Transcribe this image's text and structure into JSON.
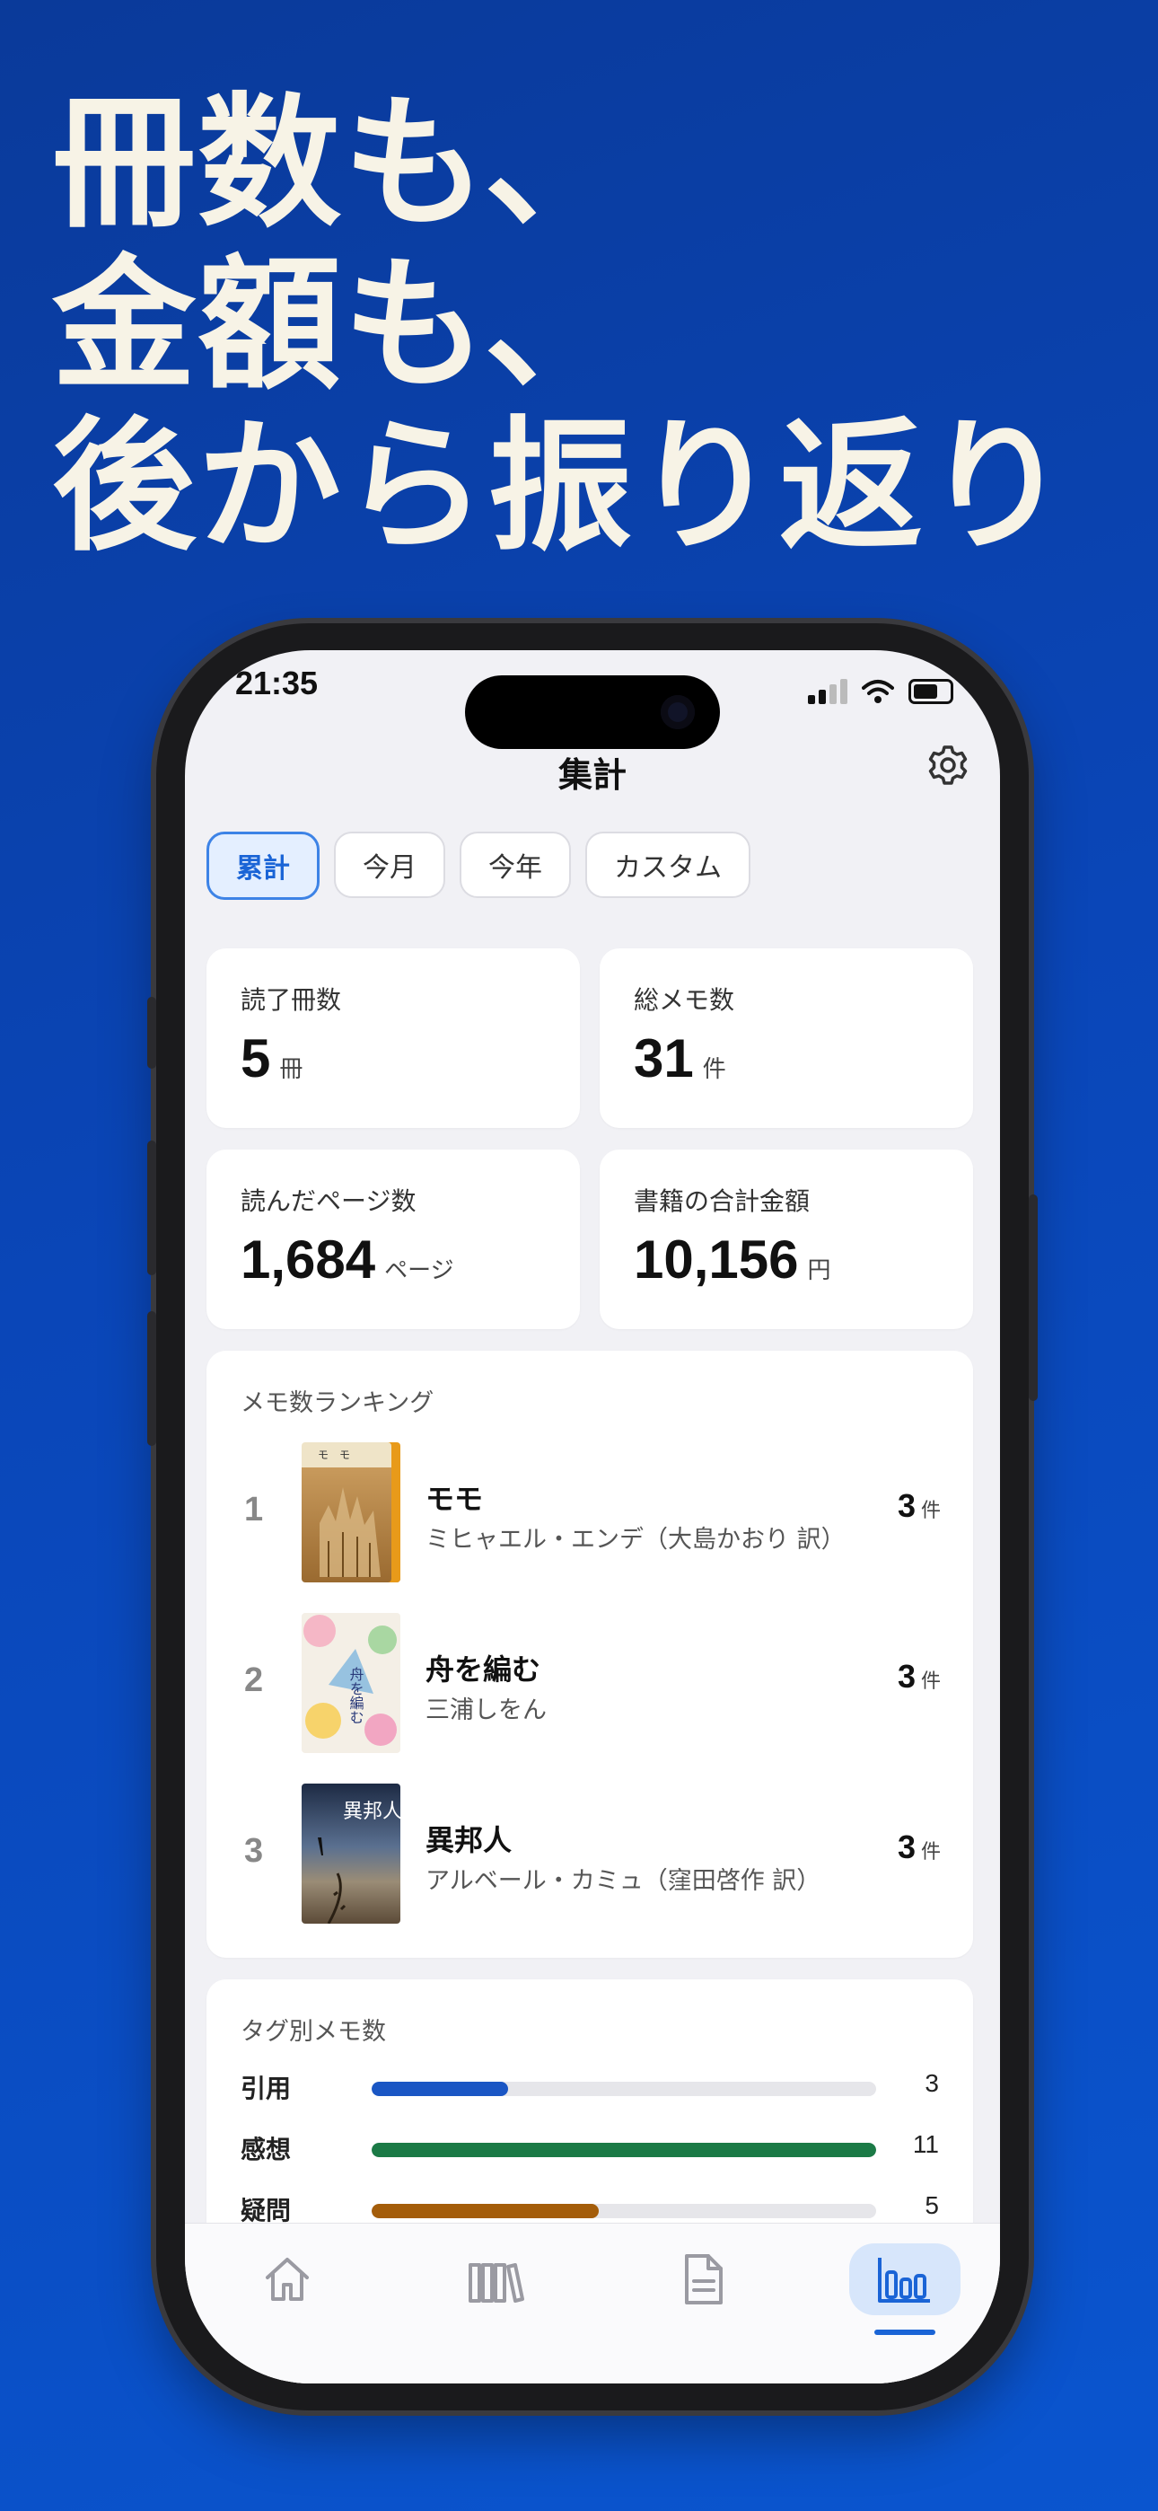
{
  "headline": [
    "冊数も、",
    "金額も、",
    "後から振り返り"
  ],
  "status": {
    "time": "21:35"
  },
  "nav": {
    "title": "集計"
  },
  "segments": [
    {
      "label": "累計",
      "selected": true
    },
    {
      "label": "今月",
      "selected": false
    },
    {
      "label": "今年",
      "selected": false
    },
    {
      "label": "カスタム",
      "selected": false
    }
  ],
  "stats": {
    "books_read": {
      "label": "読了冊数",
      "value": "5",
      "unit": "冊"
    },
    "total_memos": {
      "label": "総メモ数",
      "value": "31",
      "unit": "件"
    },
    "pages_read": {
      "label": "読んだページ数",
      "value": "1,684",
      "unit": "ページ"
    },
    "total_price": {
      "label": "書籍の合計金額",
      "value": "10,156",
      "unit": "円"
    }
  },
  "ranking": {
    "title": "メモ数ランキング",
    "items": [
      {
        "rank": "1",
        "title": "モモ",
        "author": "ミヒャエル・エンデ（大島かおり 訳）",
        "count": "3",
        "unit": "件"
      },
      {
        "rank": "2",
        "title": "舟を編む",
        "author": "三浦しをん",
        "count": "3",
        "unit": "件"
      },
      {
        "rank": "3",
        "title": "異邦人",
        "author": "アルベール・カミュ（窪田啓作 訳）",
        "count": "3",
        "unit": "件"
      }
    ]
  },
  "tags": {
    "title": "タグ別メモ数",
    "items": [
      {
        "name": "引用",
        "count": "3",
        "fraction": 0.27,
        "color": "#1a56c4"
      },
      {
        "name": "感想",
        "count": "11",
        "fraction": 1.0,
        "color": "#1b7a46"
      },
      {
        "name": "疑問",
        "count": "5",
        "fraction": 0.45,
        "color": "#a45d0a"
      }
    ]
  },
  "tabbar": {
    "items": [
      {
        "icon": "home-icon",
        "selected": false
      },
      {
        "icon": "bookshelf-icon",
        "selected": false
      },
      {
        "icon": "document-icon",
        "selected": false
      },
      {
        "icon": "chart-icon",
        "selected": true
      }
    ]
  },
  "colors": {
    "accent": "#1a64d6",
    "background": "#0a46b8",
    "headline": "#f7f3e6"
  }
}
